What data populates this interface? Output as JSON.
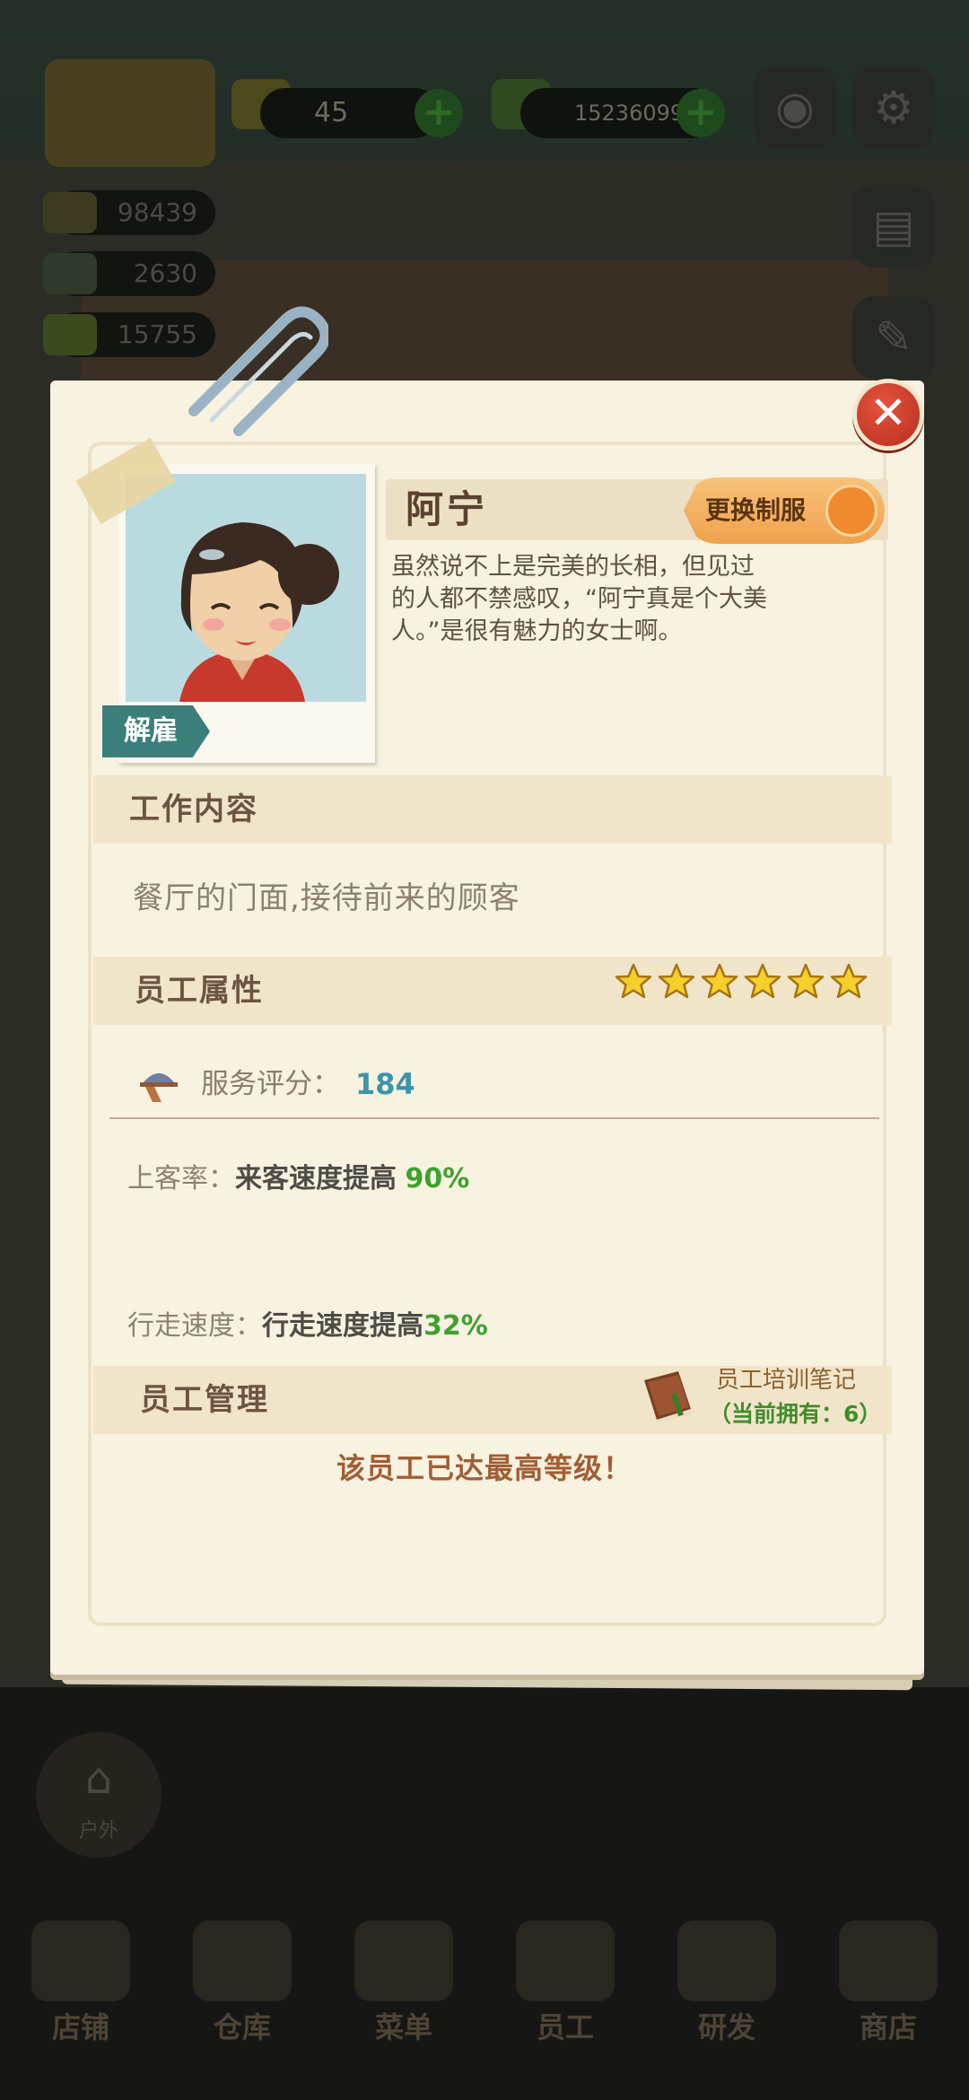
{
  "hud": {
    "gold_count": "45",
    "cash_count": "15236099",
    "stat_1": "98439",
    "stat_2": "2630",
    "stat_3": "15755"
  },
  "side_button": {
    "label": "户外"
  },
  "nav": [
    {
      "label": "店铺"
    },
    {
      "label": "仓库"
    },
    {
      "label": "菜单"
    },
    {
      "label": "员工"
    },
    {
      "label": "研发"
    },
    {
      "label": "商店"
    }
  ],
  "employee": {
    "name": "阿宁",
    "change_uniform_label": "更换制服",
    "fire_label": "解雇",
    "description": "虽然说不上是完美的长相，但见过的人都不禁感叹，“阿宁真是个大美人。”是很有魅力的女士啊。",
    "stars": 6
  },
  "sections": {
    "job_title": "工作内容",
    "job_text": "餐厅的门面,接待前来的顾客",
    "attributes_title": "员工属性",
    "management_title": "员工管理"
  },
  "attributes": {
    "service_label": "服务评分：",
    "service_value": "184",
    "customer_rate_label": "上客率：",
    "customer_rate_text": "来客速度提高",
    "customer_rate_value": "90%",
    "walk_speed_label": "行走速度：",
    "walk_speed_text": "行走速度提高",
    "walk_speed_value": "32%"
  },
  "management": {
    "notes_title": "员工培训笔记",
    "notes_count": "（当前拥有：6）",
    "max_level_text": "该员工已达最高等级！"
  },
  "colors": {
    "accent_teal": "#3b95a8",
    "accent_green": "#3fa12f",
    "close_red": "#d4412d",
    "button_orange": "#f0a14c"
  }
}
